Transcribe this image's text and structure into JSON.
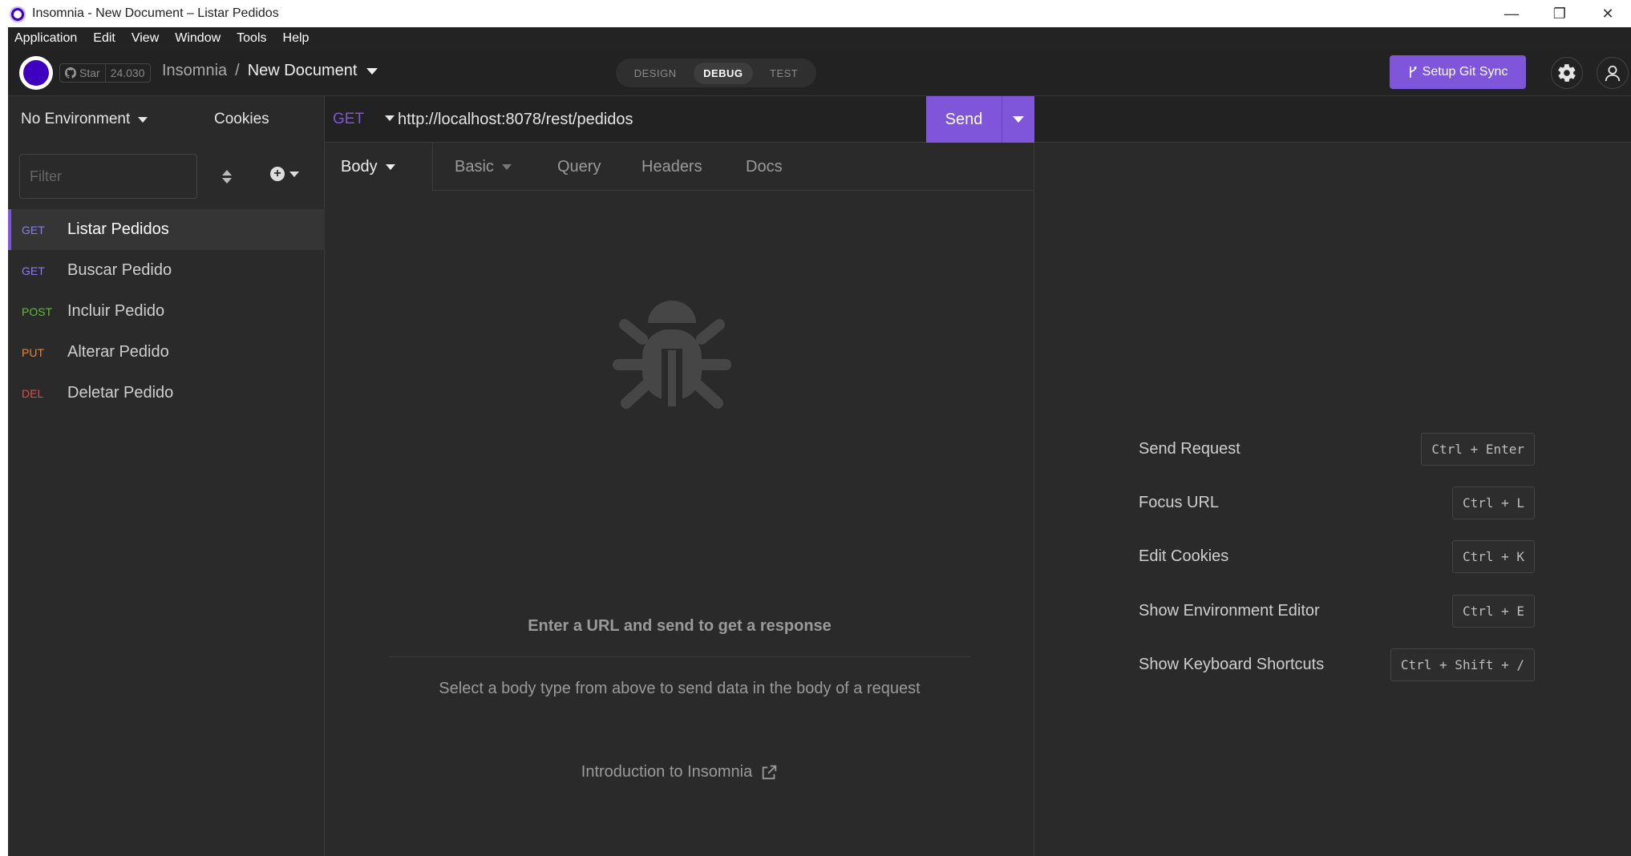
{
  "window": {
    "title": "Insomnia - New Document – Listar Pedidos",
    "minimize_glyph": "—",
    "restore_glyph": "❐",
    "close_glyph": "✕"
  },
  "menu": [
    "Application",
    "Edit",
    "View",
    "Window",
    "Tools",
    "Help"
  ],
  "header": {
    "star_label": "Star",
    "star_count": "24.030",
    "project": "Insomnia",
    "separator": "/",
    "document": "New Document",
    "modes": [
      "DESIGN",
      "DEBUG",
      "TEST"
    ],
    "active_mode": "DEBUG",
    "git_sync_label": "Setup Git Sync"
  },
  "sidebar": {
    "environment": "No Environment",
    "cookies": "Cookies",
    "filter_placeholder": "Filter",
    "requests": [
      {
        "method": "GET",
        "name": "Listar Pedidos",
        "color": "#8a7cf0",
        "active": true
      },
      {
        "method": "GET",
        "name": "Buscar Pedido",
        "color": "#8a7cf0",
        "active": false
      },
      {
        "method": "POST",
        "name": "Incluir Pedido",
        "color": "#5fbf3a",
        "active": false
      },
      {
        "method": "PUT",
        "name": "Alterar Pedido",
        "color": "#e8873a",
        "active": false
      },
      {
        "method": "DEL",
        "name": "Deletar Pedido",
        "color": "#e04e4e",
        "active": false
      }
    ]
  },
  "request": {
    "method": "GET",
    "url": "http://localhost:8078/rest/pedidos",
    "send_label": "Send",
    "tabs": {
      "body": "Body",
      "auth": "Basic",
      "query": "Query",
      "headers": "Headers",
      "docs": "Docs"
    },
    "empty_title": "Enter a URL and send to get a response",
    "empty_desc": "Select a body type from above to send data in the body of a request",
    "intro_link": "Introduction to Insomnia"
  },
  "shortcuts": [
    {
      "label": "Send Request",
      "keys": "Ctrl + Enter"
    },
    {
      "label": "Focus URL",
      "keys": "Ctrl + L"
    },
    {
      "label": "Edit Cookies",
      "keys": "Ctrl + K"
    },
    {
      "label": "Show Environment Editor",
      "keys": "Ctrl + E"
    },
    {
      "label": "Show Keyboard Shortcuts",
      "keys": "Ctrl + Shift + /"
    }
  ],
  "colors": {
    "accent": "#7f56d9",
    "background": "#2a2a2a",
    "header": "#222222"
  }
}
